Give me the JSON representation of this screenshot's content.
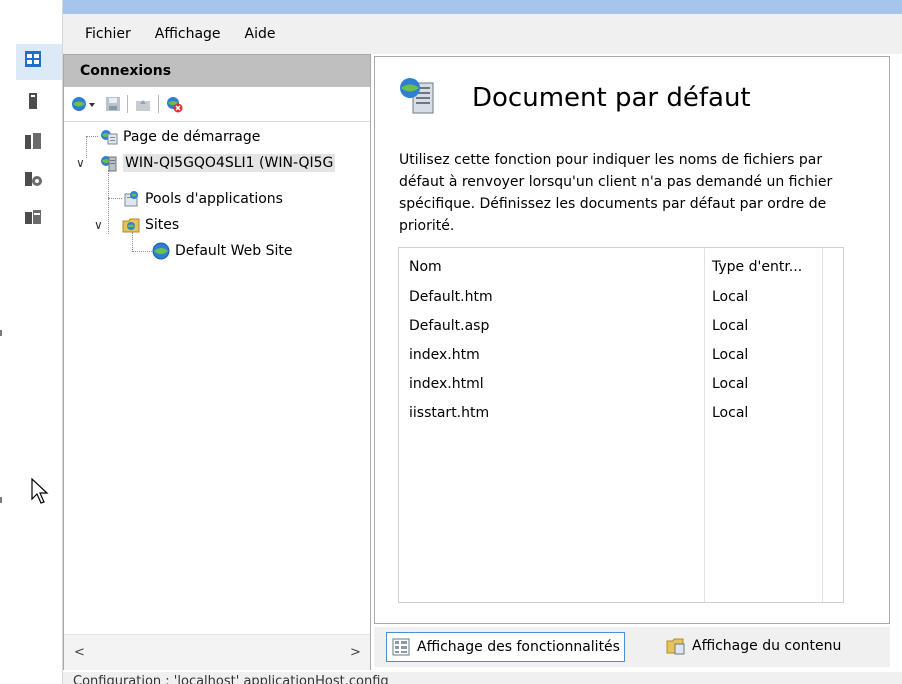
{
  "menu": {
    "items": [
      "Fichier",
      "Affichage",
      "Aide"
    ]
  },
  "connections": {
    "title": "Connexions",
    "toolbar": [
      {
        "icon": "connect-globe-icon"
      },
      {
        "icon": "save-icon"
      },
      {
        "icon": "up-folder-icon"
      },
      {
        "icon": "disconnect-icon"
      }
    ],
    "tree": [
      {
        "label": "Page de démarrage",
        "icon": "start-page-icon",
        "level": 0
      },
      {
        "label": "WIN-QI5GQO4SLI1 (WIN-QI5G",
        "icon": "server-icon",
        "level": 0,
        "expanded": true,
        "selected": true
      },
      {
        "label": "Pools d'applications",
        "icon": "app-pools-icon",
        "level": 1
      },
      {
        "label": "Sites",
        "icon": "sites-folder-icon",
        "level": 1,
        "expanded": true
      },
      {
        "label": "Default Web Site",
        "icon": "website-globe-icon",
        "level": 2
      }
    ]
  },
  "main": {
    "title": "Document par défaut",
    "description": "Utilisez cette fonction pour indiquer les noms de fichiers par défaut à renvoyer lorsqu'un client n'a pas demandé un fichier spécifique. Définissez les documents par défaut par ordre de priorité.",
    "columns": [
      "Nom",
      "Type d'entr..."
    ],
    "rows": [
      {
        "name": "Default.htm",
        "type": "Local"
      },
      {
        "name": "Default.asp",
        "type": "Local"
      },
      {
        "name": "index.htm",
        "type": "Local"
      },
      {
        "name": "index.html",
        "type": "Local"
      },
      {
        "name": "iisstart.htm",
        "type": "Local"
      }
    ]
  },
  "views": {
    "features": "Affichage des fonctionnalités",
    "content": "Affichage du contenu"
  },
  "status": {
    "text": "Configuration : 'localhost' applicationHost.config"
  },
  "colors": {
    "accent": "#4a90d9",
    "header_gray": "#bfbfbf",
    "top_bar": "#a7c5ec"
  }
}
